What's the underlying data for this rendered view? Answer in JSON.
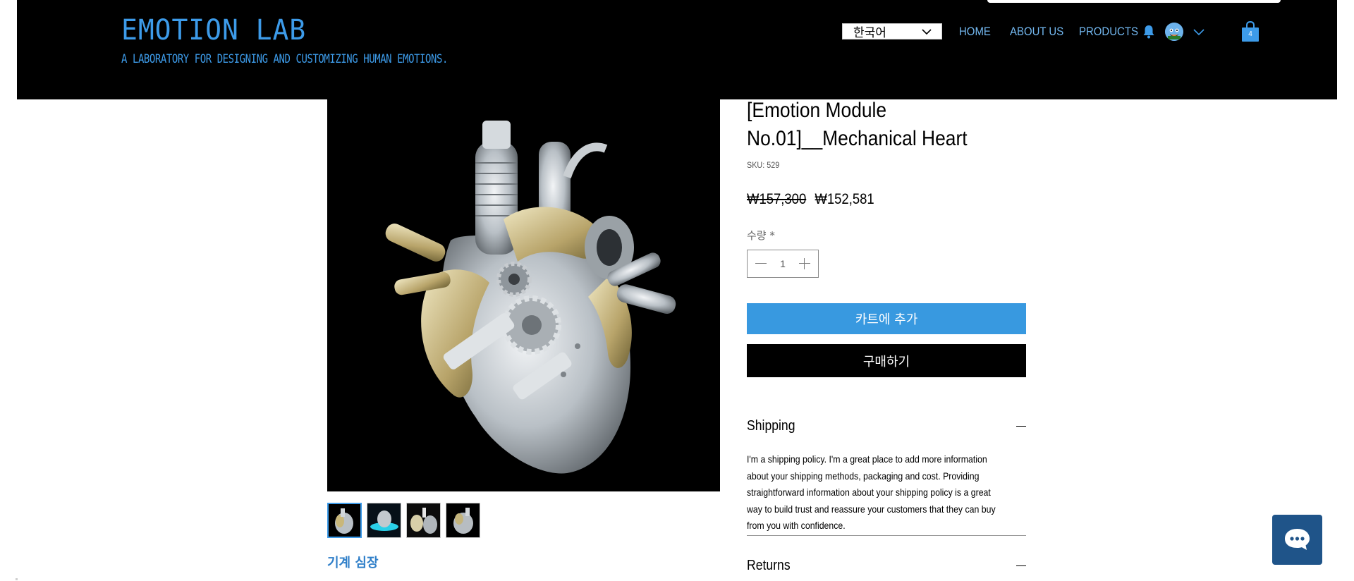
{
  "header": {
    "brand_title": "EMOTION LAB",
    "tagline": "A laboratory for designing and customizing human emotions.",
    "language": "한국어",
    "nav": {
      "home": "HOME",
      "about": "ABOUT US",
      "products": "PRODUCTS"
    },
    "cart_count": "4",
    "accent_color": "#3d9be9"
  },
  "product": {
    "title": "[Emotion Module No.01]__Mechanical Heart",
    "sku_label": "SKU: 529",
    "price_original": "₩157,300",
    "price_sale": "₩152,581",
    "quantity_label": "수량 *",
    "quantity_value": "1",
    "add_to_cart_label": "카트에 추가",
    "buy_now_label": "구매하기",
    "subname": "기계 심장",
    "thumbnail_count": 4
  },
  "info_sections": {
    "shipping": {
      "title": "Shipping",
      "body": "I'm a shipping policy. I'm a great place to add more information about your shipping methods, packaging and cost. Providing straightforward information about your shipping policy is a great way to build trust and reassure your customers that they can buy from you with confidence."
    },
    "returns": {
      "title": "Returns"
    }
  },
  "icons": {
    "bell": "bell-icon",
    "cart": "shopping-bag-icon",
    "chat": "chat-icon"
  }
}
